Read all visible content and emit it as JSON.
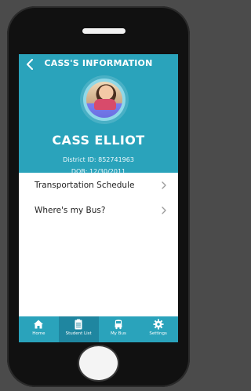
{
  "header": {
    "title": "CASS'S INFORMATION"
  },
  "student": {
    "name": "CASS ELLIOT",
    "district_id_line": "District ID: 852741963",
    "dob_line": "DOB: 12/30/2011"
  },
  "menu": {
    "items": [
      {
        "label": "Transportation Schedule"
      },
      {
        "label": "Where's my Bus?"
      }
    ]
  },
  "tabs": [
    {
      "label": "Home",
      "icon": "home-icon",
      "active": false
    },
    {
      "label": "Student List",
      "icon": "clipboard-icon",
      "active": true
    },
    {
      "label": "My Bus",
      "icon": "bus-icon",
      "active": false
    },
    {
      "label": "Settings",
      "icon": "gear-icon",
      "active": false
    }
  ],
  "colors": {
    "brand": "#2aa3bb",
    "tab_active": "#1f86a0",
    "background": "#4b4b4b"
  }
}
